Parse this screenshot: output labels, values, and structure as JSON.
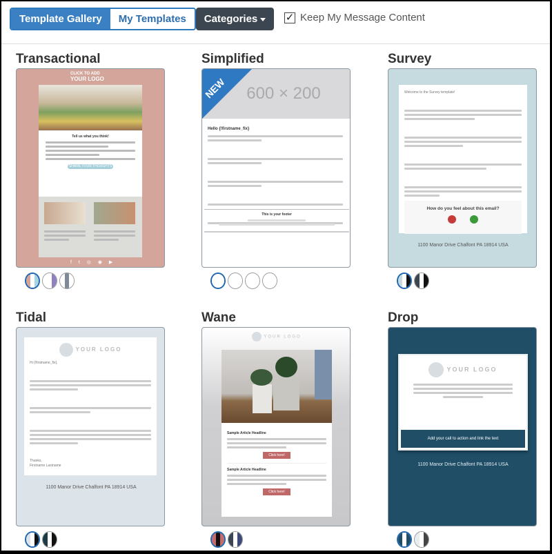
{
  "toolbar": {
    "tab_gallery": "Template Gallery",
    "tab_my": "My Templates",
    "categories": "Categories",
    "keep_content": "Keep My Message Content",
    "keep_checked": true
  },
  "templates": [
    {
      "name": "Transactional",
      "bg": "#d4a59a",
      "logo": "YOUR LOGO",
      "logo_small": "CLICK TO ADD",
      "heading": "Tell us what you think!",
      "button": "SHARE YOUR THOUGHTS",
      "swatches": [
        [
          "#d4a59a",
          "#fff",
          "#a8d4e0"
        ],
        [
          "#fff",
          "#fff",
          "#8f80c0"
        ],
        [
          "#fff",
          "#7d8a98",
          "#fff"
        ]
      ],
      "selected": 0
    },
    {
      "name": "Simplified",
      "bg": "#ffffff",
      "badge": "NEW",
      "placeholder": "600 × 200",
      "heading": "Hello {!firstname_fix}",
      "footer": "This is your footer",
      "swatches": [
        [
          "#fff"
        ],
        [
          "#fff"
        ],
        [
          "#fff"
        ],
        [
          "#fff"
        ]
      ],
      "selected": 0
    },
    {
      "name": "Survey",
      "bg": "#c5dbe0",
      "intro": "Welcome to the Survey template!",
      "question": "How do you feel about this email?",
      "address": "1100 Manor Drive Chalfont PA 18914 USA",
      "swatches": [
        [
          "#c5dbe0",
          "#fff",
          "#111"
        ],
        [
          "#3c4650",
          "#fff",
          "#111"
        ]
      ],
      "selected": 0
    },
    {
      "name": "Tidal",
      "bg": "#dce3e9",
      "logo": "YOUR LOGO",
      "greeting": "Hi {!firstname_fix},",
      "signoff": "Thanks,",
      "signature": "Firstname Lastname",
      "address": "1100 Manor Drive Chalfont PA 18914 USA",
      "swatches": [
        [
          "#dce3e9",
          "#fff",
          "#111"
        ],
        [
          "#1e3a44",
          "#fff",
          "#111"
        ]
      ],
      "selected": 0
    },
    {
      "name": "Wane",
      "bg": "#d0d0d2",
      "logo": "YOUR LOGO",
      "headline": "Sample Article Headline",
      "button": "Click here!",
      "swatches": [
        [
          "#c76a6a",
          "#111",
          "#c76a6a"
        ],
        [
          "#3c4650",
          "#fff",
          "#3c4a78"
        ]
      ],
      "selected": 0
    },
    {
      "name": "Drop",
      "bg": "#1f4e66",
      "logo": "YOUR LOGO",
      "cta": "Add your call to action and link the text",
      "address": "1100 Manor Drive Chalfont PA 18914 USA",
      "swatches": [
        [
          "#1f4e66",
          "#fff",
          "#1f4e66"
        ],
        [
          "#e8eef0",
          "#fff",
          "#444"
        ]
      ],
      "selected": 0
    }
  ]
}
